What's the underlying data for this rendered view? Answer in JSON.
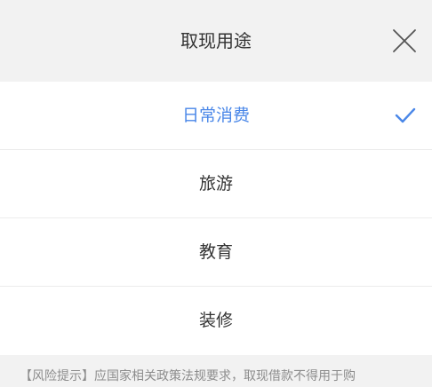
{
  "dialog": {
    "title": "取现用途",
    "close_icon": "close-icon"
  },
  "options": [
    {
      "label": "日常消费",
      "selected": true
    },
    {
      "label": "旅游",
      "selected": false
    },
    {
      "label": "教育",
      "selected": false
    },
    {
      "label": "装修",
      "selected": false
    }
  ],
  "footer": {
    "risk_text": "【风险提示】应国家相关政策法规要求，取现借款不得用于购"
  },
  "colors": {
    "accent": "#4a87e8",
    "text": "#333333",
    "muted": "#8c8c8c",
    "background": "#f2f2f2"
  }
}
